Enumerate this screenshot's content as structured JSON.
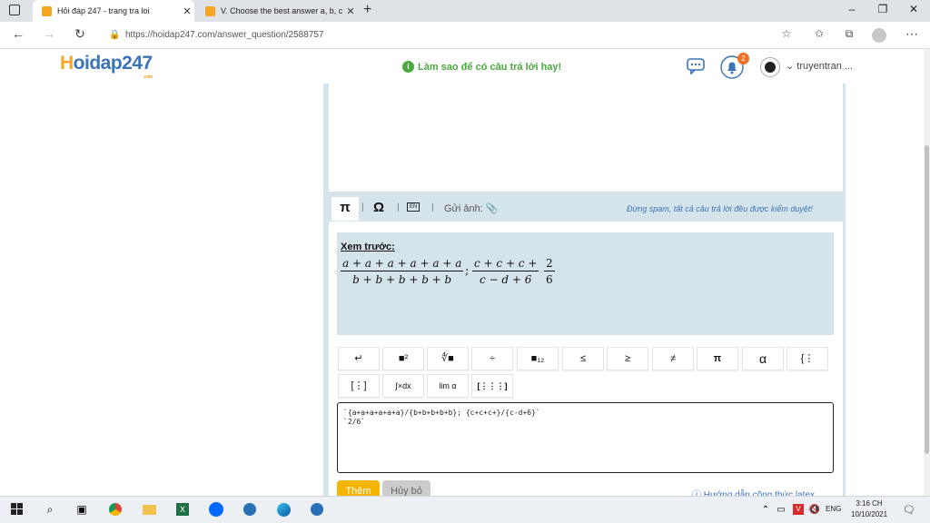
{
  "browser": {
    "tabs": [
      {
        "title": "Hỏi đáp 247 - trang tra loi",
        "close": "✕",
        "active": true
      },
      {
        "title": "V. Choose the best answer a, b, c",
        "close": "✕",
        "active": false
      }
    ],
    "new_tab": "+",
    "url": "https://hoidap247.com/answer_question/2588757",
    "window_controls": {
      "minimize": "–",
      "maximize": "❐",
      "close": "✕"
    }
  },
  "site": {
    "logo": {
      "h": "H",
      "rest": "oidap247",
      "sub": ".com"
    },
    "tip": "Làm sao để có câu trả lời hay!",
    "notification_count": "2",
    "username": "truyentran ..."
  },
  "editor": {
    "tab_pi": "π",
    "tab_omega": "Ω",
    "tab_en": "EN",
    "upload_label": "Gửi ảnh:",
    "spam_note": "Đừng spam, tất cả câu trả lời đều được kiểm duyệt!",
    "preview_label": "Xem trước:",
    "preview": {
      "f1_num": "a + a + a + a + a + a",
      "f1_den": "b + b + b + b + b",
      "sep": ";",
      "f2_num": "c + c + c +",
      "f2_den": "c − d + 6",
      "f3_num": "2",
      "f3_den": "6"
    },
    "math_buttons_row1": [
      "↵",
      "■²",
      "∜■",
      "÷",
      "■₁₂",
      "≤",
      "≥",
      "≠",
      "π",
      "α",
      "{⋮"
    ],
    "math_buttons_row2": [
      "[⋮]",
      "∫×dx",
      "lim α",
      "[⋮⋮⋮]"
    ],
    "latex_line1": "`{a+a+a+a+a+a}/{b+b+b+b+b}; {c+c+c+}/{c-d+6}`",
    "latex_line2": "`2/6`",
    "add_button": "Thêm",
    "cancel_button": "Hủy bỏ",
    "guide_link": "Hướng dẫn công thức latex"
  },
  "taskbar": {
    "lang": "ENG",
    "time": "3:16 CH",
    "date": "10/10/2021"
  },
  "colors": {
    "brand_blue": "#3b73b9",
    "brand_orange": "#f5a623",
    "tip_green": "#4aa83f",
    "panel": "#d4e4ea",
    "add_button": "#f5b400"
  }
}
